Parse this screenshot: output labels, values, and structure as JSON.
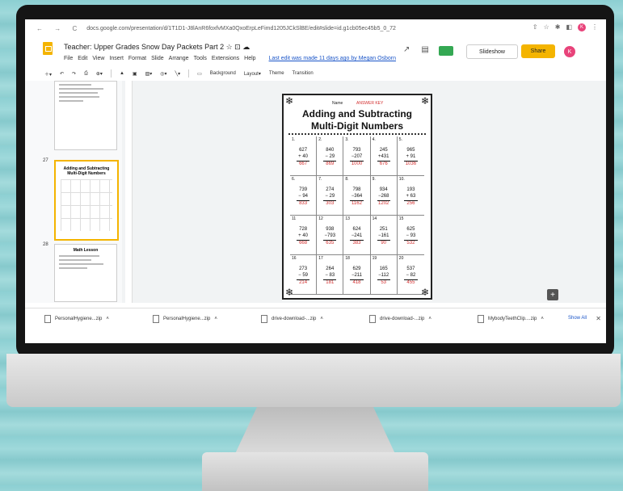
{
  "browser": {
    "url": "docs.google.com/presentation/d/1T1D1-J8lAnR6foxfvMXa0QxoErpLeFimd1205JCkSlBE/edit#slide=id.g1cb05ec45b5_0_72",
    "nav_icons": "← → C",
    "right_icons": [
      "⇧",
      "☆",
      "✱",
      "◧",
      "K",
      "⋮"
    ]
  },
  "doc": {
    "title": "Teacher: Upper Grades Snow Day Packets Part 2",
    "title_icons": "☆ ⊡ ☁",
    "menus": [
      "File",
      "Edit",
      "View",
      "Insert",
      "Format",
      "Slide",
      "Arrange",
      "Tools",
      "Extensions",
      "Help"
    ],
    "last_edit": "Last edit was made 11 days ago by Megan Osborn",
    "slideshow_label": "Slideshow",
    "share_label": "Share",
    "avatar_letter": "K"
  },
  "toolbar": {
    "items": [
      "Background",
      "Layout▾",
      "Theme",
      "Transition"
    ]
  },
  "filmstrip": {
    "slide_numbers": [
      "27",
      "28"
    ],
    "thumb_title_1": "Adding and Subtracting",
    "thumb_title_2": "Multi-Digit Numbers",
    "thumb_28_title": "Math Lesson"
  },
  "slide": {
    "name_label": "Name",
    "key_label": "ANSWER KEY",
    "title_line1": "Adding and Subtracting",
    "title_line2": "Multi-Digit Numbers",
    "problems": [
      {
        "n": "1.",
        "a": "627",
        "b": "+ 40",
        "ans": "667"
      },
      {
        "n": "2.",
        "a": "840",
        "b": "− 29",
        "ans": "869"
      },
      {
        "n": "3.",
        "a": "793",
        "b": "−207",
        "ans": "1000"
      },
      {
        "n": "4.",
        "a": "245",
        "b": "+431",
        "ans": "676"
      },
      {
        "n": "5.",
        "a": "965",
        "b": "+ 91",
        "ans": "1036"
      },
      {
        "n": "6.",
        "a": "739",
        "b": "− 94",
        "ans": "833"
      },
      {
        "n": "7.",
        "a": "274",
        "b": "− 29",
        "ans": "303"
      },
      {
        "n": "8.",
        "a": "798",
        "b": "−364",
        "ans": "1162"
      },
      {
        "n": "9.",
        "a": "934",
        "b": "−268",
        "ans": "1202"
      },
      {
        "n": "10.",
        "a": "193",
        "b": "+ 63",
        "ans": "256"
      },
      {
        "n": "11",
        "a": "728",
        "b": "+ 40",
        "ans": "668"
      },
      {
        "n": "12",
        "a": "938",
        "b": "−793",
        "ans": "635"
      },
      {
        "n": "13",
        "a": "624",
        "b": "−241",
        "ans": "383"
      },
      {
        "n": "14",
        "a": "251",
        "b": "−161",
        "ans": "90"
      },
      {
        "n": "15",
        "a": "625",
        "b": "− 93",
        "ans": "532"
      },
      {
        "n": "16",
        "a": "273",
        "b": "− 59",
        "ans": "214"
      },
      {
        "n": "17",
        "a": "264",
        "b": "− 83",
        "ans": "181"
      },
      {
        "n": "18",
        "a": "629",
        "b": "−211",
        "ans": "418"
      },
      {
        "n": "19",
        "a": "165",
        "b": "−112",
        "ans": "53"
      },
      {
        "n": "20",
        "a": "537",
        "b": "− 82",
        "ans": "455"
      }
    ]
  },
  "downloads": {
    "items": [
      "PersonalHygiene...zip",
      "PersonalHygiene...zip",
      "drive-download-...zip",
      "drive-download-...zip",
      "MybodyTeethClip....zip"
    ],
    "show_all": "Show All"
  },
  "colors": {
    "accent": "#f4b400",
    "answer": "#d32f2f"
  }
}
